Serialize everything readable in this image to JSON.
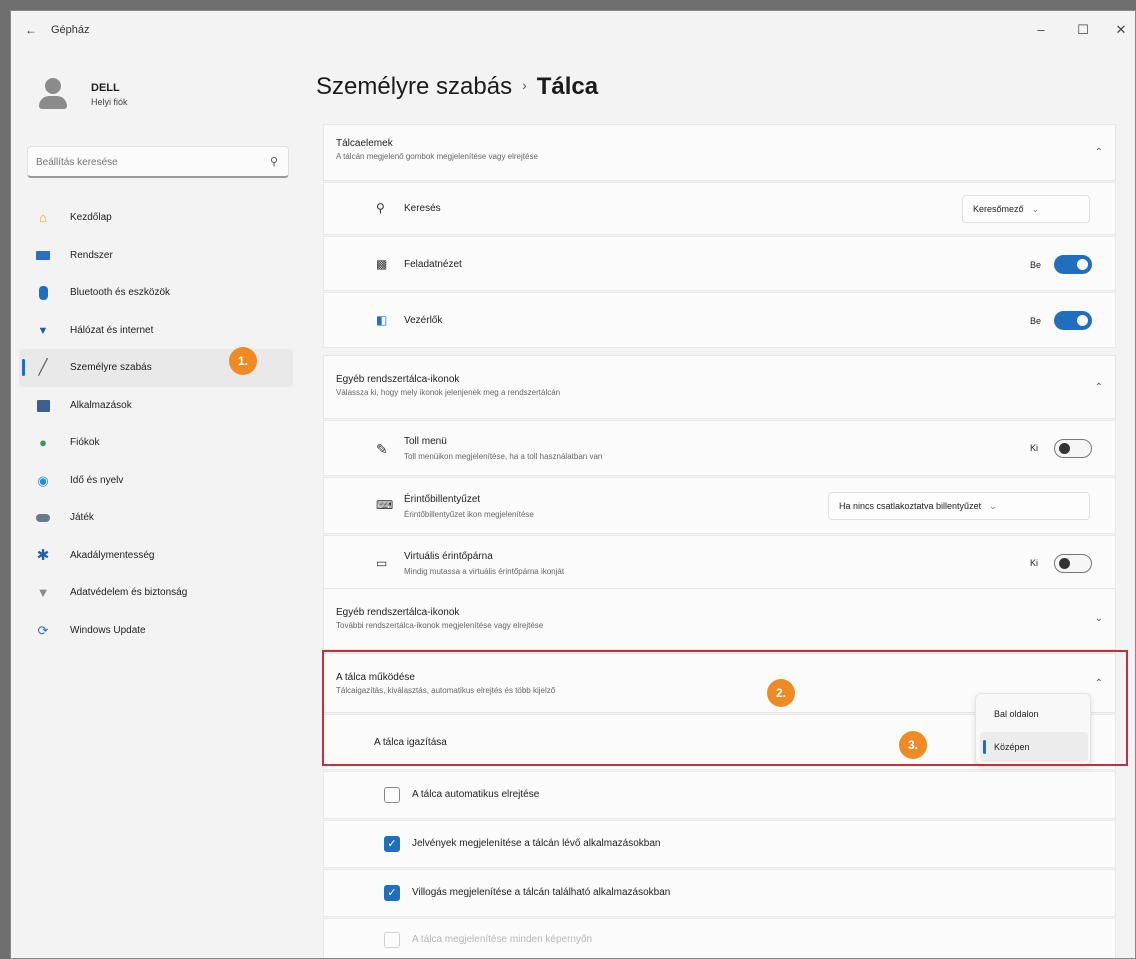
{
  "window": {
    "title": "Gépház",
    "back": "←",
    "minimize": "–",
    "maximize": "☐",
    "close": "✕"
  },
  "user": {
    "name": "DELL",
    "subtitle": "Helyi fiók"
  },
  "search": {
    "placeholder": "Beállítás keresése",
    "icon": "search-icon"
  },
  "sidebar": {
    "items": [
      {
        "label": "Kezdőlap",
        "icon": "home-icon"
      },
      {
        "label": "Rendszer",
        "icon": "monitor-icon"
      },
      {
        "label": "Bluetooth és eszközök",
        "icon": "bluetooth-icon"
      },
      {
        "label": "Hálózat és internet",
        "icon": "wifi-icon"
      },
      {
        "label": "Személyre szabás",
        "icon": "brush-icon",
        "selected": true
      },
      {
        "label": "Alkalmazások",
        "icon": "apps-icon"
      },
      {
        "label": "Fiókok",
        "icon": "person-icon"
      },
      {
        "label": "Idő és nyelv",
        "icon": "globe-clock-icon"
      },
      {
        "label": "Játék",
        "icon": "gamepad-icon"
      },
      {
        "label": "Akadálymentesség",
        "icon": "accessibility-icon"
      },
      {
        "label": "Adatvédelem és biztonság",
        "icon": "shield-icon"
      },
      {
        "label": "Windows Update",
        "icon": "update-icon"
      }
    ]
  },
  "badges": {
    "one": "1.",
    "two": "2.",
    "three": "3."
  },
  "breadcrumb": {
    "parent": "Személyre szabás",
    "separator": "›",
    "current": "Tálca"
  },
  "sections": {
    "taskbar_items": {
      "title": "Tálcaelemek",
      "subtitle": "A tálcán megjelenő gombok megjelenítése vagy elrejtése",
      "rows": {
        "search": {
          "label": "Keresés",
          "value": "Keresőmező"
        },
        "taskview": {
          "label": "Feladatnézet",
          "state": "Be"
        },
        "widgets": {
          "label": "Vezérlők",
          "state": "Be"
        }
      }
    },
    "corner_icons": {
      "title": "Egyéb rendszertálca-ikonok",
      "subtitle": "Válassza ki, hogy mely ikonok jelenjenek meg a rendszertálcán",
      "rows": {
        "pen": {
          "label": "Toll menü",
          "sub": "Toll menüikon megjelenítése, ha a toll használatban van",
          "state": "Ki"
        },
        "touch_keyboard": {
          "label": "Érintőbillentyűzet",
          "sub": "Érintőbillentyűzet ikon megjelenítése",
          "value": "Ha nincs csatlakoztatva billentyűzet"
        },
        "touchpad": {
          "label": "Virtuális érintőpárna",
          "sub": "Mindig mutassa a virtuális érintőpárna ikonját",
          "state": "Ki"
        }
      }
    },
    "overflow": {
      "title": "Egyéb rendszertálca-ikonok",
      "subtitle": "További rendszertálca-ikonok megjelenítése vagy elrejtése"
    },
    "behaviors": {
      "title": "A tálca működése",
      "subtitle": "Tálcaigazítás, kiválasztás, automatikus elrejtés és több kijelző",
      "alignment_label": "A tálca igazítása",
      "alignment_options": [
        "Bal oldalon",
        "Középen"
      ],
      "alignment_selected": "Középen"
    }
  },
  "checkboxes": [
    {
      "label": "A tálca automatikus elrejtése",
      "checked": false
    },
    {
      "label": "Jelvények megjelenítése a tálcán lévő alkalmazásokban",
      "checked": true
    },
    {
      "label": "Villogás megjelenítése a tálcán található alkalmazásokban",
      "checked": true
    },
    {
      "label": "A tálca megjelenítése minden képernyőn",
      "checked": false,
      "disabled": true
    }
  ],
  "colors": {
    "accent": "#1f6fbe",
    "badge": "#f08a24",
    "highlight": "#c0313b"
  }
}
